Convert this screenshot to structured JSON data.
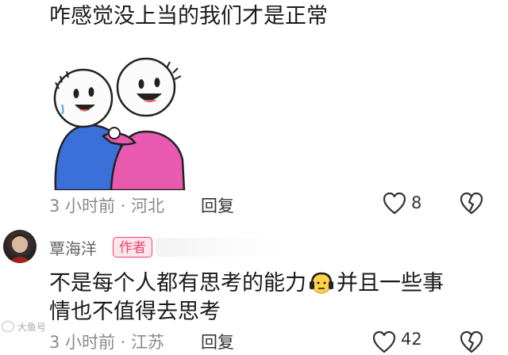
{
  "prev_comment": {
    "text": "咋感觉没上当的我们才是正常",
    "time_location": "3 小时前 · 河北",
    "reply_label": "回复",
    "like_count": "8",
    "sticker_icon": "two-cartoon-friends-hug-sticker"
  },
  "author_comment": {
    "name": "覃海洋",
    "badge": "作者",
    "line1_a": "不是每个人都有思考的能力",
    "emoji": "headphone-face-emoji",
    "line1_b": "并且一些事",
    "line2": "情也不值得去思考",
    "time_location": "3 小时前 · 江苏",
    "reply_label": "回复",
    "like_count": "42"
  },
  "watermark": "大鱼号"
}
